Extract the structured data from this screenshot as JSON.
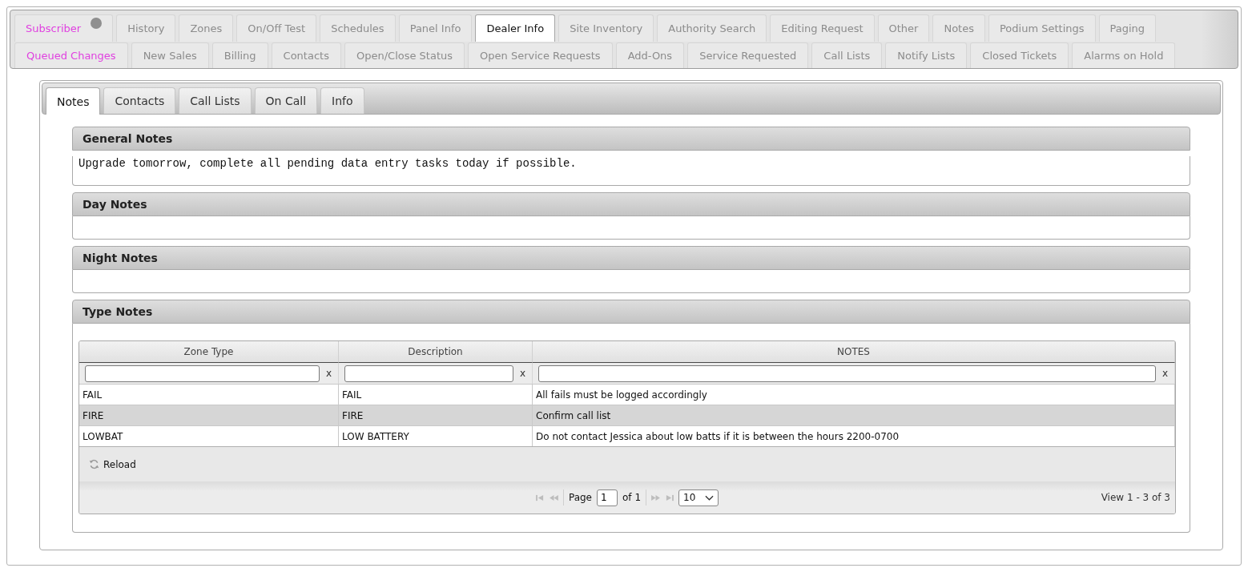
{
  "top_tabs": [
    [
      {
        "label": "Subscriber",
        "selected": false,
        "color": "#e040e0",
        "dot": true
      },
      {
        "label": "History",
        "selected": false,
        "color": "#8c8c8c",
        "dot": false
      },
      {
        "label": "Zones",
        "selected": false,
        "color": "#8c8c8c",
        "dot": false
      },
      {
        "label": "On/Off Test",
        "selected": false,
        "color": "#8c8c8c",
        "dot": false
      },
      {
        "label": "Schedules",
        "selected": false,
        "color": "#8c8c8c",
        "dot": false
      },
      {
        "label": "Panel Info",
        "selected": false,
        "color": "#8c8c8c",
        "dot": false
      },
      {
        "label": "Dealer Info",
        "selected": true,
        "color": "#111111",
        "dot": false
      },
      {
        "label": "Site Inventory",
        "selected": false,
        "color": "#8c8c8c",
        "dot": false
      },
      {
        "label": "Authority Search",
        "selected": false,
        "color": "#8c8c8c",
        "dot": false
      },
      {
        "label": "Editing Request",
        "selected": false,
        "color": "#8c8c8c",
        "dot": false
      },
      {
        "label": "Other",
        "selected": false,
        "color": "#8c8c8c",
        "dot": false
      },
      {
        "label": "Notes",
        "selected": false,
        "color": "#8c8c8c",
        "dot": false
      },
      {
        "label": "Podium Settings",
        "selected": false,
        "color": "#8c8c8c",
        "dot": false
      },
      {
        "label": "Paging",
        "selected": false,
        "color": "#8c8c8c",
        "dot": false
      }
    ],
    [
      {
        "label": "Queued Changes",
        "selected": false,
        "color": "#e040e0",
        "dot": false
      },
      {
        "label": "New Sales",
        "selected": false,
        "color": "#8c8c8c",
        "dot": false
      },
      {
        "label": "Billing",
        "selected": false,
        "color": "#8c8c8c",
        "dot": false
      },
      {
        "label": "Contacts",
        "selected": false,
        "color": "#8c8c8c",
        "dot": false
      },
      {
        "label": "Open/Close Status",
        "selected": false,
        "color": "#8c8c8c",
        "dot": false
      },
      {
        "label": "Open Service Requests",
        "selected": false,
        "color": "#8c8c8c",
        "dot": false
      },
      {
        "label": "Add-Ons",
        "selected": false,
        "color": "#8c8c8c",
        "dot": false
      },
      {
        "label": "Service Requested",
        "selected": false,
        "color": "#8c8c8c",
        "dot": false
      },
      {
        "label": "Call Lists",
        "selected": false,
        "color": "#8c8c8c",
        "dot": false
      },
      {
        "label": "Notify Lists",
        "selected": false,
        "color": "#8c8c8c",
        "dot": false
      },
      {
        "label": "Closed Tickets",
        "selected": false,
        "color": "#8c8c8c",
        "dot": false
      },
      {
        "label": "Alarms on Hold",
        "selected": false,
        "color": "#8c8c8c",
        "dot": false
      }
    ]
  ],
  "inner_tabs": [
    {
      "label": "Notes",
      "selected": true
    },
    {
      "label": "Contacts",
      "selected": false
    },
    {
      "label": "Call Lists",
      "selected": false
    },
    {
      "label": "On Call",
      "selected": false
    },
    {
      "label": "Info",
      "selected": false
    }
  ],
  "sections": [
    {
      "kind": "text",
      "title": "General Notes",
      "text": "Upgrade tomorrow, complete all pending data entry tasks today if possible."
    },
    {
      "kind": "text",
      "title": "Day Notes"
    },
    {
      "kind": "text",
      "title": "Night Notes"
    },
    {
      "kind": "grid",
      "title": "Type Notes",
      "grid": {
        "columns": [
          {
            "label": "Zone Type",
            "clear": "x"
          },
          {
            "label": "Description",
            "clear": "x"
          },
          {
            "label": "NOTES",
            "clear": "x"
          }
        ],
        "rows": [
          {
            "selected": false,
            "cells": [
              "FAIL",
              "FAIL",
              "All fails must be logged accordingly"
            ]
          },
          {
            "selected": true,
            "cells": [
              "FIRE",
              "FIRE",
              "Confirm call list"
            ]
          },
          {
            "selected": false,
            "cells": [
              "LOWBAT",
              "LOW BATTERY",
              "Do not contact Jessica about low batts if it is between the hours 2200-0700"
            ]
          }
        ],
        "reload": "Reload",
        "pager": {
          "nav": [
            {
              "kind": "first",
              "disabled": true
            },
            {
              "kind": "prev",
              "disabled": true
            },
            {
              "kind": "next",
              "disabled": true
            },
            {
              "kind": "last",
              "disabled": true
            }
          ],
          "page_label": "Page",
          "page": "1",
          "of": "of 1",
          "page_size": "10",
          "records": "View 1 - 3 of 3"
        }
      }
    }
  ]
}
